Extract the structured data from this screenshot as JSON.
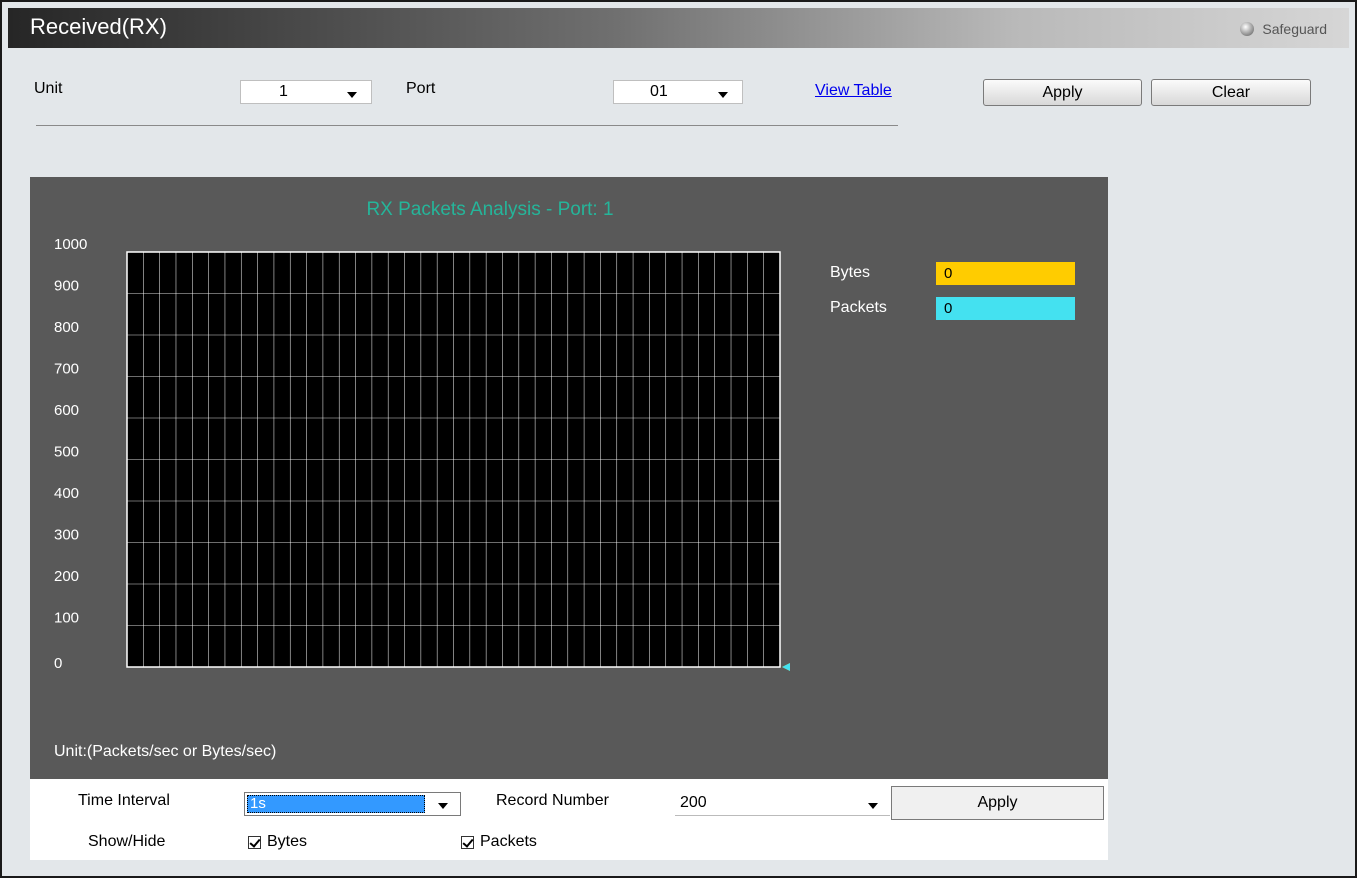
{
  "header": {
    "title": "Received(RX)",
    "safeguard_label": "Safeguard"
  },
  "selectors": {
    "unit_label": "Unit",
    "unit_value": "1",
    "port_label": "Port",
    "port_value": "01",
    "view_table_link": "View Table"
  },
  "buttons": {
    "apply": "Apply",
    "clear": "Clear",
    "apply_bottom": "Apply"
  },
  "chart_data": {
    "type": "line",
    "title": "RX Packets Analysis - Port: 1",
    "ylim": [
      0,
      1000
    ],
    "y_ticks": [
      "1000",
      "900",
      "800",
      "700",
      "600",
      "500",
      "400",
      "300",
      "200",
      "100",
      "0"
    ],
    "grid": true,
    "legend_placement": "right",
    "series": [
      {
        "name": "Bytes",
        "color": "#ffcc00",
        "current_value": "0",
        "values": []
      },
      {
        "name": "Packets",
        "color": "#44e1f0",
        "current_value": "0",
        "values": []
      }
    ],
    "unit_note": "Unit:(Packets/sec or Bytes/sec)"
  },
  "controls": {
    "time_interval_label": "Time Interval",
    "time_interval_value": "1s",
    "record_number_label": "Record Number",
    "record_number_value": "200",
    "show_hide_label": "Show/Hide",
    "bytes_checkbox_label": "Bytes",
    "bytes_checked": true,
    "packets_checkbox_label": "Packets",
    "packets_checked": true
  }
}
